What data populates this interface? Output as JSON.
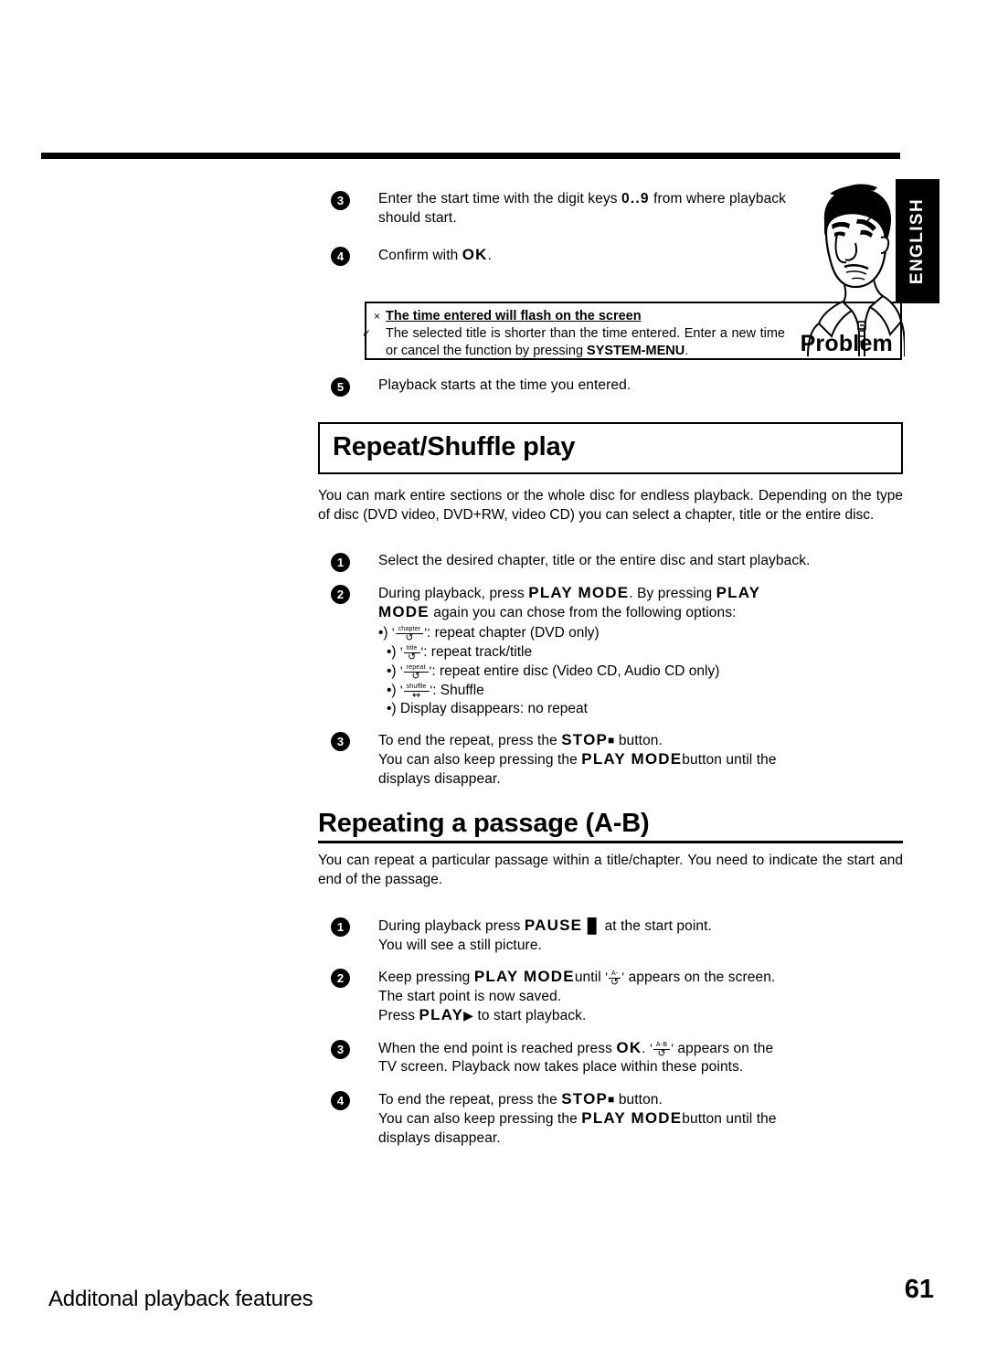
{
  "page": {
    "language_tab": "ENGLISH",
    "footer_title": "Additonal playback features",
    "footer_page_number": "61"
  },
  "top_section": {
    "steps": [
      {
        "number": "3",
        "line_pre": "Enter the start time with the digit keys",
        "key": "0..9",
        "line_post": "from where playback",
        "line2": "should start."
      },
      {
        "number": "4",
        "line_pre": "Confirm with",
        "key": "OK",
        "line_post": "."
      }
    ],
    "problem_box": {
      "error_mark": "×",
      "error_text": "The time entered will flash on the screen",
      "check_mark": "✓",
      "solution_pre": "The selected title is shorter than the time entered. Enter a new time or cancel the function by pressing",
      "solution_key": "SYSTEM-MENU",
      "solution_post": ".",
      "label": "Problem"
    },
    "step5": {
      "number": "5",
      "text": "Playback starts at the time you entered."
    }
  },
  "repeat_shuffle": {
    "heading": "Repeat/Shuffle play",
    "intro": "You can mark entire sections or the whole disc for endless playback. Depending on the type of disc (DVD video, DVD+RW, video CD) you can select a chapter, title or the entire disc.",
    "steps": [
      {
        "number": "1",
        "text": "Select the desired chapter, title or the entire disc and start playback."
      },
      {
        "number": "2",
        "line1_a": "During playback, press",
        "line1_key1": "PLAY MODE",
        "line1_b": ". By pressing",
        "line1_key2": "PLAY",
        "line2_key": "MODE",
        "line2_text": "again you can chose from the following options:",
        "options": [
          {
            "bullet": "•)",
            "icon_label": "chapter",
            "icon_arrow": "↺",
            "text": ": repeat chapter (DVD only)"
          },
          {
            "bullet": "•)",
            "icon_label": "title",
            "icon_arrow": "↺",
            "text": ": repeat track/title"
          },
          {
            "bullet": "•)",
            "icon_label": "repeat",
            "icon_arrow": "↺",
            "text": ": repeat entire disc (Video CD, Audio CD only)"
          },
          {
            "bullet": "•)",
            "icon_label": "shuffle",
            "icon_arrow": "↭",
            "text": ": Shuffle"
          },
          {
            "bullet": "•)",
            "icon_label": "",
            "icon_arrow": "",
            "text": "Display disappears: no repeat"
          }
        ]
      },
      {
        "number": "3",
        "line1_a": "To end the repeat, press the",
        "line1_key": "STOP",
        "line1_icon": "■",
        "line1_b": "button.",
        "line2_a": "You can also keep pressing the",
        "line2_key": "PLAY MODE",
        "line2_b": "button until the",
        "line3": "displays disappear."
      }
    ]
  },
  "repeating_passage": {
    "heading": "Repeating a passage (A-B)",
    "intro": "You can repeat a particular passage within a title/chapter. You need to indicate the start and end of the passage.",
    "steps": [
      {
        "number": "1",
        "line1_a": "During playback press",
        "line1_key": "PAUSE",
        "line1_icon": "▐▌",
        "line1_b": "at the start point.",
        "line2": "You will see a still picture."
      },
      {
        "number": "2",
        "line1_a": "Keep pressing",
        "line1_key": "PLAY MODE",
        "line1_b": "until",
        "icon_label": "A-",
        "icon_arrow": "↺",
        "line1_c": "appears on the screen.",
        "line2": "The start point is now saved.",
        "line3_a": "Press",
        "line3_key": "PLAY",
        "line3_icon": "▶",
        "line3_b": "to start playback."
      },
      {
        "number": "3",
        "line1_a": "When the end point is reached press",
        "line1_key": "OK",
        "line1_b": ".",
        "icon_label": "A-B",
        "icon_arrow": "↺",
        "line1_c": "appears on the",
        "line2": "TV screen. Playback now takes place within these points."
      },
      {
        "number": "4",
        "line1_a": "To end the repeat, press the",
        "line1_key": "STOP",
        "line1_icon": "■",
        "line1_b": "button.",
        "line2_a": "You can also keep pressing the",
        "line2_key": "PLAY MODE",
        "line2_b": "button until the",
        "line3": "displays disappear."
      }
    ]
  }
}
